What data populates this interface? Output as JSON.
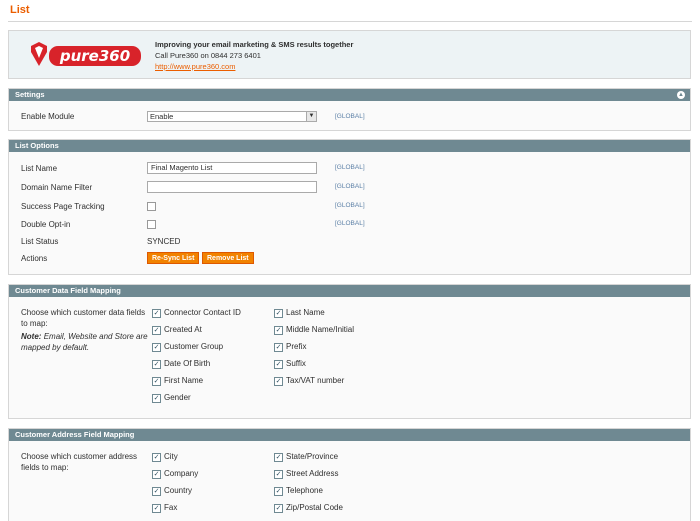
{
  "page": {
    "title": "List"
  },
  "banner": {
    "logo_text": "pure360",
    "headline": "Improving your email marketing & SMS results together",
    "phone": "Call Pure360 on 0844 273 6401",
    "link": "http://www.pure360.com"
  },
  "settings": {
    "header": "Settings",
    "enable_label": "Enable Module",
    "enable_value": "Enable",
    "scope": "[GLOBAL]"
  },
  "list_options": {
    "header": "List Options",
    "list_name_label": "List Name",
    "list_name_value": "Final Magento List",
    "domain_label": "Domain Name Filter",
    "domain_value": "",
    "success_label": "Success Page Tracking",
    "double_label": "Double Opt-in",
    "status_label": "List Status",
    "status_value": "SYNCED",
    "actions_label": "Actions",
    "resync": "Re-Sync List",
    "remove": "Remove List",
    "scope": "[GLOBAL]"
  },
  "customer_data": {
    "header": "Customer Data Field Mapping",
    "description": "Choose which customer data fields to map:",
    "note_label": "Note:",
    "note_text": "Email, Website and Store are mapped by default.",
    "col1": [
      "Connector Contact ID",
      "Created At",
      "Customer Group",
      "Date Of Birth",
      "First Name",
      "Gender"
    ],
    "col2": [
      "Last Name",
      "Middle Name/Initial",
      "Prefix",
      "Suffix",
      "Tax/VAT number"
    ]
  },
  "customer_address": {
    "header": "Customer Address Field Mapping",
    "description": "Choose which customer address fields to map:",
    "col1": [
      "City",
      "Company",
      "Country",
      "Fax"
    ],
    "col2": [
      "State/Province",
      "Street Address",
      "Telephone",
      "Zip/Postal Code"
    ]
  },
  "checkmark": "✓",
  "collapse_icon": "▲"
}
